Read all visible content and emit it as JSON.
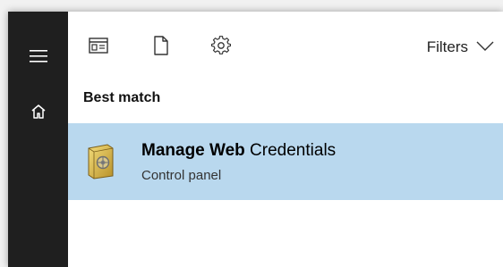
{
  "rail": {
    "menu_icon": "hamburger-icon",
    "home_icon": "home-icon"
  },
  "toolbar": {
    "icons": [
      "apps-icon",
      "document-icon",
      "settings-gear-icon"
    ],
    "filters_label": "Filters",
    "filters_icon": "chevron-down-icon"
  },
  "results": {
    "section_title": "Best match",
    "best_match": {
      "title_bold": "Manage Web",
      "title_rest": " Credentials",
      "subtitle": "Control panel",
      "icon": "credential-manager-vault-icon"
    }
  },
  "colors": {
    "rail_bg": "#1f1f1f",
    "selected_bg": "#b9d8ee",
    "page_bg": "#ffffff"
  }
}
